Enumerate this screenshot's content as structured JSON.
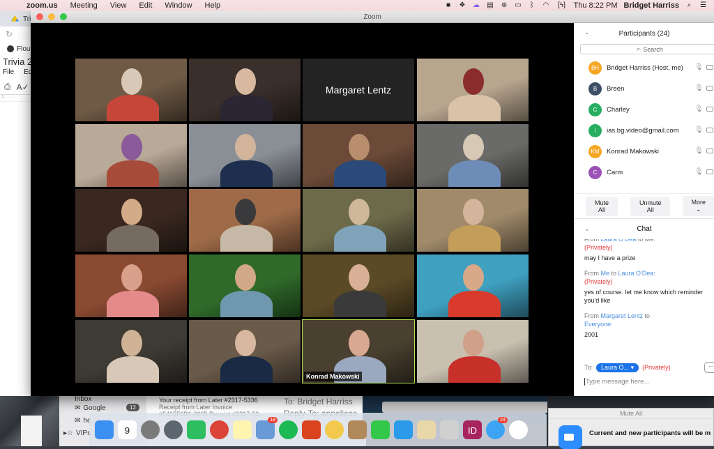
{
  "menubar": {
    "app_name": "zoom.us",
    "menus": [
      "Meeting",
      "View",
      "Edit",
      "Window",
      "Help"
    ],
    "clock": "Thu 8:22 PM",
    "user": "Bridget Harriss",
    "status_icons": [
      "zoom-icon",
      "dropbox-icon",
      "cloud-icon",
      "printer-icon",
      "creative-cloud-icon",
      "airplay-icon",
      "bluetooth-icon",
      "wifi-icon",
      "battery-icon"
    ]
  },
  "background_browser": {
    "tab_label": "Tri",
    "bookmark_label": "Flou",
    "doc_title": "Trivia 2",
    "doc_menus": [
      "File",
      "Edi"
    ]
  },
  "zoom_window": {
    "title": "Zoom",
    "gallery": {
      "tiles": [
        {
          "id": 1,
          "type": "video",
          "label": ""
        },
        {
          "id": 2,
          "type": "video",
          "label": ""
        },
        {
          "id": 3,
          "type": "name-card",
          "label": "Margaret Lentz"
        },
        {
          "id": 4,
          "type": "video",
          "label": ""
        },
        {
          "id": 5,
          "type": "video",
          "label": ""
        },
        {
          "id": 6,
          "type": "video",
          "label": ""
        },
        {
          "id": 7,
          "type": "video",
          "label": ""
        },
        {
          "id": 8,
          "type": "video",
          "label": ""
        },
        {
          "id": 9,
          "type": "video",
          "label": ""
        },
        {
          "id": 10,
          "type": "video",
          "label": ""
        },
        {
          "id": 11,
          "type": "video",
          "label": ""
        },
        {
          "id": 12,
          "type": "video",
          "label": ""
        },
        {
          "id": 13,
          "type": "video",
          "label": ""
        },
        {
          "id": 14,
          "type": "video",
          "label": ""
        },
        {
          "id": 15,
          "type": "video",
          "label": ""
        },
        {
          "id": 16,
          "type": "video",
          "label": ""
        },
        {
          "id": 17,
          "type": "video",
          "label": ""
        },
        {
          "id": 18,
          "type": "video",
          "label": ""
        },
        {
          "id": 19,
          "type": "video-active-speaker",
          "label": "Konrad Makowski"
        },
        {
          "id": 20,
          "type": "video",
          "label": ""
        }
      ]
    },
    "participants": {
      "header": "Participants (24)",
      "search_placeholder": "Search",
      "list": [
        {
          "initials": "BH",
          "name": "Bridget Harriss (Host, me)",
          "color": "#f5a623"
        },
        {
          "initials": "B",
          "name": "Breen",
          "color": "#3d4f66"
        },
        {
          "initials": "C",
          "name": "Charley",
          "color": "#27ae60"
        },
        {
          "initials": "i",
          "name": "ias.bg.video@gmail.com",
          "color": "#27ae60"
        },
        {
          "initials": "KM",
          "name": "Konrad Makowski",
          "color": "#f5a623"
        },
        {
          "initials": "C",
          "name": "Carm",
          "color": "#9b51b6"
        }
      ],
      "buttons": {
        "mute_all": "Mute All",
        "unmute_all": "Unmute All",
        "more": "More"
      }
    },
    "chat": {
      "header": "Chat",
      "messages": [
        {
          "from_prefix": "From ",
          "from": "Laura O'Dea",
          "to_prefix": " to ",
          "to": "Me:",
          "privately": "(Privately)",
          "text": "may I have a prize"
        },
        {
          "from_prefix": "From ",
          "from": "Me",
          "to_prefix": " to ",
          "to": "Laura O'Dea:",
          "privately": "(Privately)",
          "text": "yes of course. let me know which reminder you'd like"
        },
        {
          "from_prefix": "From ",
          "from": "Margaret Lentz",
          "to_prefix": " to ",
          "to": "Everyone:",
          "privately": "",
          "text": "2001"
        }
      ],
      "to_label": "To:",
      "recipient": "Laura O...",
      "privately": "(Privately)",
      "more_label": "···",
      "input_placeholder": "Type message here..."
    }
  },
  "desktop": {
    "mail": {
      "sidebar": [
        {
          "label": "Inbox",
          "count": ""
        },
        {
          "label": "Google",
          "count": "12"
        },
        {
          "label": "he",
          "count": ""
        },
        {
          "label": "VIPs",
          "count": ""
        }
      ],
      "message": {
        "subject": "Your receipt from Later #2317-5336",
        "preview1": "Receipt from Later Invoice",
        "preview2": "#5415F8B1-0005 Receipt #2317-53..."
      },
      "header_to": "To:  Bridget Harriss",
      "header_reply_to": "Reply-To:  anneliese"
    },
    "dock": {
      "apps": [
        {
          "name": "finder",
          "color": "#3b8ff0",
          "badge": ""
        },
        {
          "name": "calendar",
          "color": "#ffffff",
          "badge": "",
          "text": "9",
          "month": "APR"
        },
        {
          "name": "system-preferences",
          "color": "#7a7a7a",
          "badge": ""
        },
        {
          "name": "launchpad",
          "color": "#5c6670",
          "badge": ""
        },
        {
          "name": "evernote",
          "color": "#2dbe60",
          "badge": ""
        },
        {
          "name": "chrome",
          "color": "#db4437",
          "badge": ""
        },
        {
          "name": "notes",
          "color": "#fff4b0",
          "badge": ""
        },
        {
          "name": "mail",
          "color": "#6a9ad6",
          "badge": "18"
        },
        {
          "name": "spotify",
          "color": "#1db954",
          "badge": ""
        },
        {
          "name": "toolbox",
          "color": "#d9441e",
          "badge": ""
        },
        {
          "name": "photos",
          "color": "#f2c94c",
          "badge": ""
        },
        {
          "name": "contacts",
          "color": "#b08a5a",
          "badge": ""
        },
        {
          "name": "facetime",
          "color": "#34c84a",
          "badge": ""
        },
        {
          "name": "word",
          "color": "#2b9ae8",
          "badge": ""
        },
        {
          "name": "archive-utility",
          "color": "#e8d7a8",
          "badge": ""
        },
        {
          "name": "calculator",
          "color": "#d0d0d0",
          "badge": ""
        },
        {
          "name": "indesign",
          "color": "#a7245e",
          "badge": "",
          "text": "ID"
        },
        {
          "name": "messages",
          "color": "#3da4f4",
          "badge": "24"
        },
        {
          "name": "slack",
          "color": "#ffffff",
          "badge": ""
        }
      ]
    },
    "notification": {
      "title": "Mute All",
      "message": "Current and new participants will be m"
    }
  }
}
